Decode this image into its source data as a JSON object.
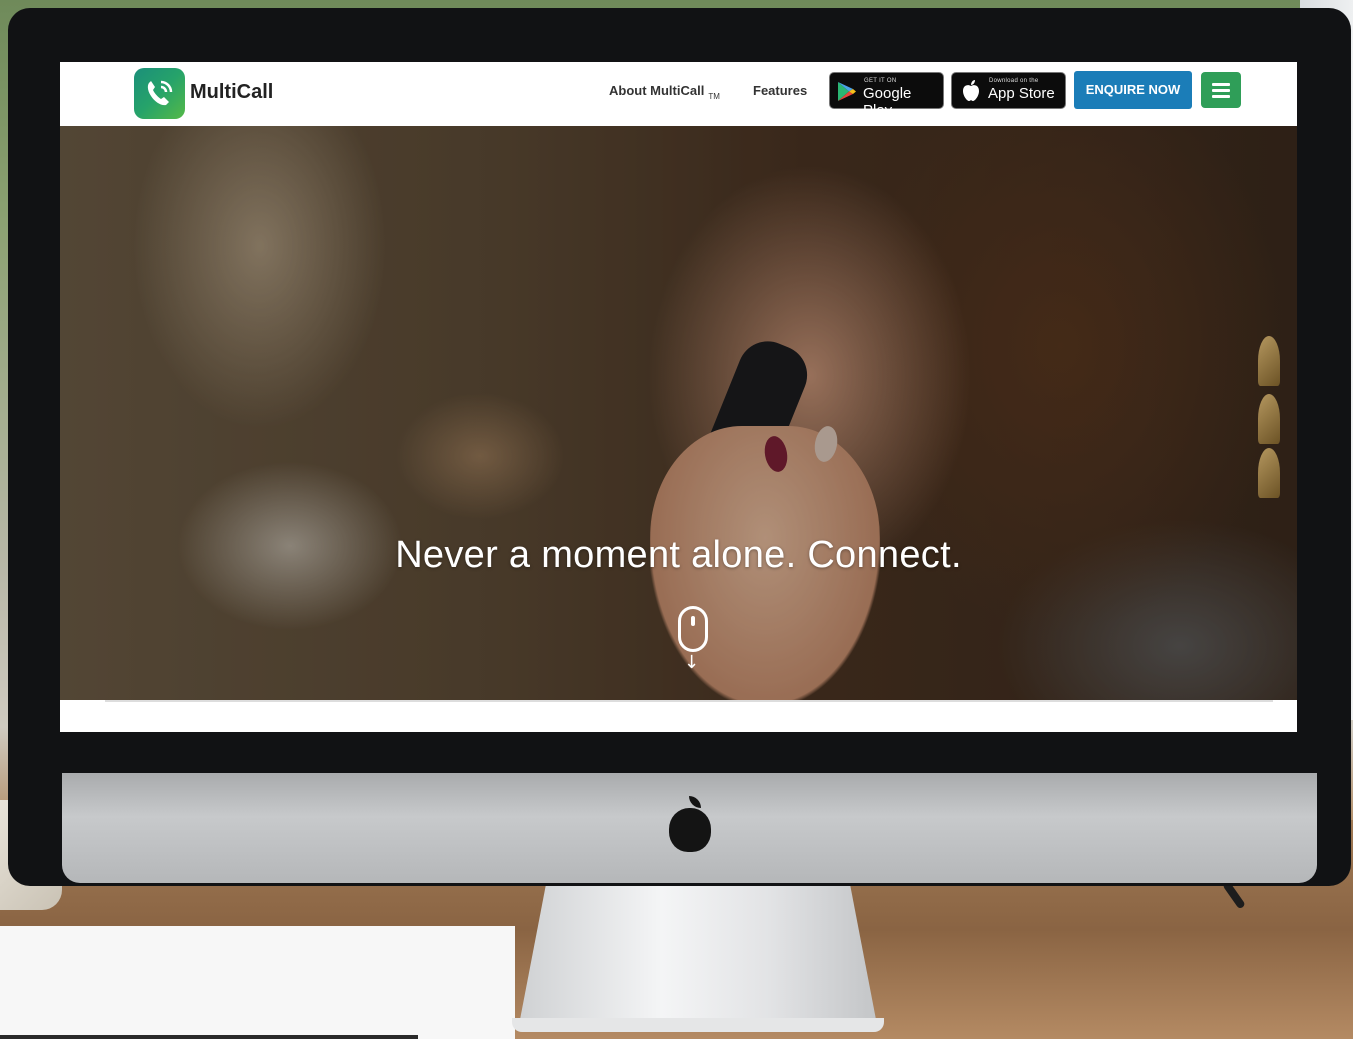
{
  "brand": {
    "name": "MultiCall"
  },
  "nav": {
    "about_label": "About MultiCall",
    "about_tm": "TM",
    "features_label": "Features",
    "google_play": {
      "small": "GET IT ON",
      "big": "Google Play"
    },
    "app_store": {
      "small": "Download on the",
      "big": "App Store"
    },
    "enquire_label": "ENQUIRE NOW"
  },
  "hero": {
    "headline": "Never a moment alone. Connect."
  },
  "colors": {
    "enquire_bg": "#1b7db8",
    "menu_bg": "#2f9e58",
    "logo_gradient_start": "#1b8f7a",
    "logo_gradient_end": "#55b947"
  },
  "icons": [
    "phone-logo-icon",
    "google-play-icon",
    "apple-icon",
    "hamburger-icon",
    "scroll-mouse-icon",
    "arrow-down-icon",
    "apple-logo-icon"
  ]
}
